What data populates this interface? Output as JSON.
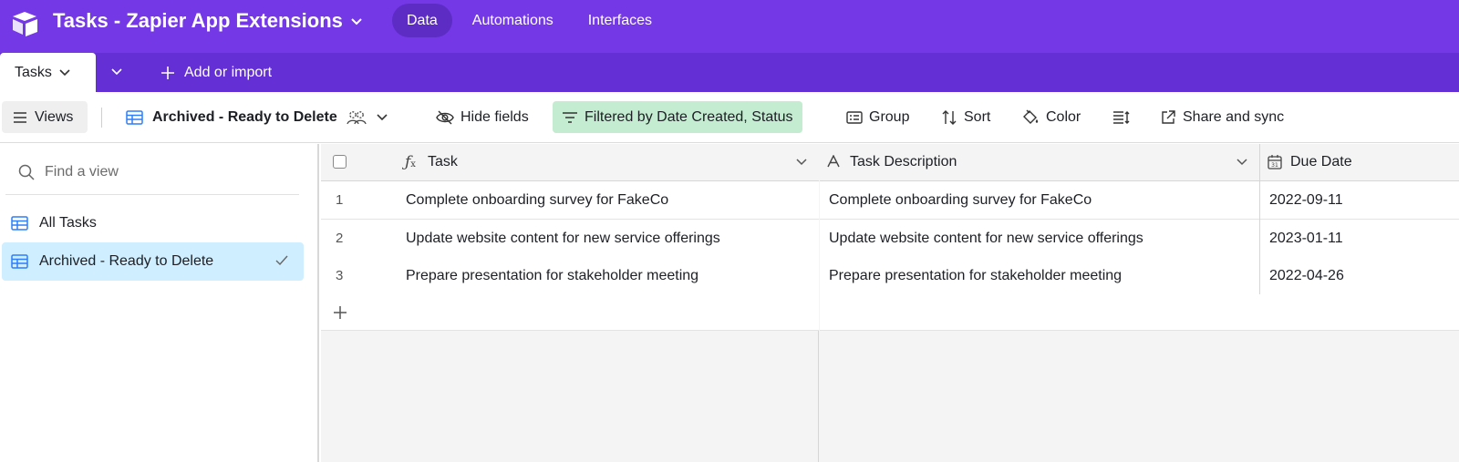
{
  "app": {
    "base_title": "Tasks - Zapier App Extensions",
    "nav": [
      {
        "label": "Data",
        "active": true
      },
      {
        "label": "Automations",
        "active": false
      },
      {
        "label": "Interfaces",
        "active": false
      }
    ],
    "accent": "#7438e6"
  },
  "tabs": {
    "active_table": "Tasks",
    "add_import": "Add or import"
  },
  "toolbar": {
    "views_label": "Views",
    "view_name": "Archived - Ready to Delete",
    "hide_fields": "Hide fields",
    "filter": "Filtered by Date Created, Status",
    "group": "Group",
    "sort": "Sort",
    "color": "Color",
    "share": "Share and sync"
  },
  "sidebar": {
    "search_placeholder": "Find a view",
    "views": [
      {
        "label": "All Tasks",
        "selected": false
      },
      {
        "label": "Archived - Ready to Delete",
        "selected": true
      }
    ]
  },
  "grid": {
    "columns": [
      {
        "label": "Task",
        "type": "formula-icon"
      },
      {
        "label": "Task Description",
        "type": "text-icon"
      },
      {
        "label": "Due Date",
        "type": "calendar-icon"
      }
    ],
    "rows": [
      {
        "num": "1",
        "task": "Complete onboarding survey for FakeCo",
        "description": "Complete onboarding survey for FakeCo",
        "due": "2022-09-11"
      },
      {
        "num": "2",
        "task": "Update website content for new service offerings",
        "description": "Update website content for new service offerings",
        "due": "2023-01-11"
      },
      {
        "num": "3",
        "task": "Prepare presentation for stakeholder meeting",
        "description": "Prepare presentation for stakeholder meeting",
        "due": "2022-04-26"
      }
    ]
  }
}
